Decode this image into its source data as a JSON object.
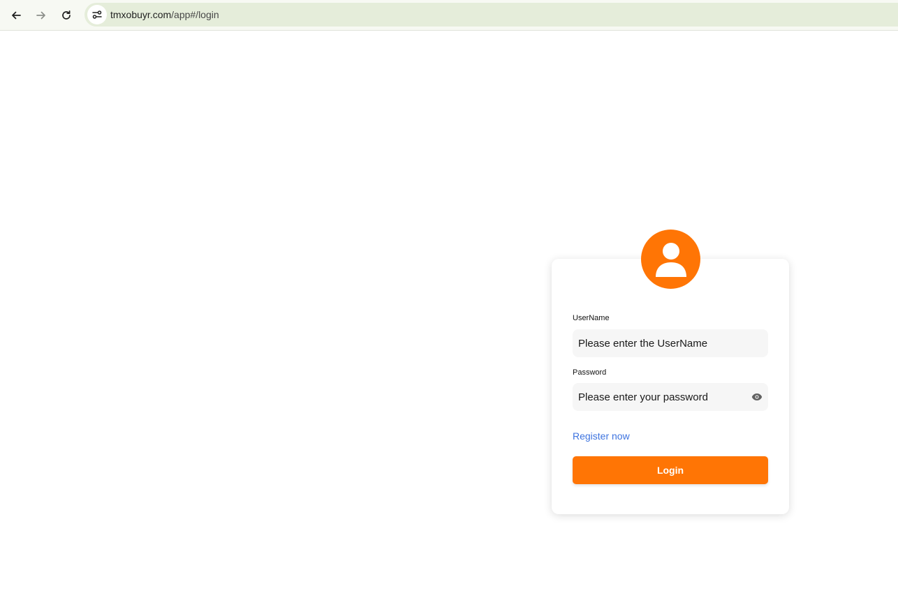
{
  "browser": {
    "url_host": "tmxobuyr.com",
    "url_path": "/app#/login"
  },
  "login": {
    "username_label": "UserName",
    "username_placeholder": "Please enter the UserName",
    "password_label": "Password",
    "password_placeholder": "Please enter your password",
    "register_link": "Register now",
    "login_button": "Login"
  },
  "colors": {
    "accent": "#ff7505",
    "link": "#3d73df",
    "input_bg": "#f6f6f6"
  },
  "icons": {
    "back": "back-arrow-icon",
    "forward": "forward-arrow-icon",
    "reload": "reload-icon",
    "site_info": "tune-icon",
    "avatar": "user-icon",
    "password_toggle": "eye-icon"
  }
}
